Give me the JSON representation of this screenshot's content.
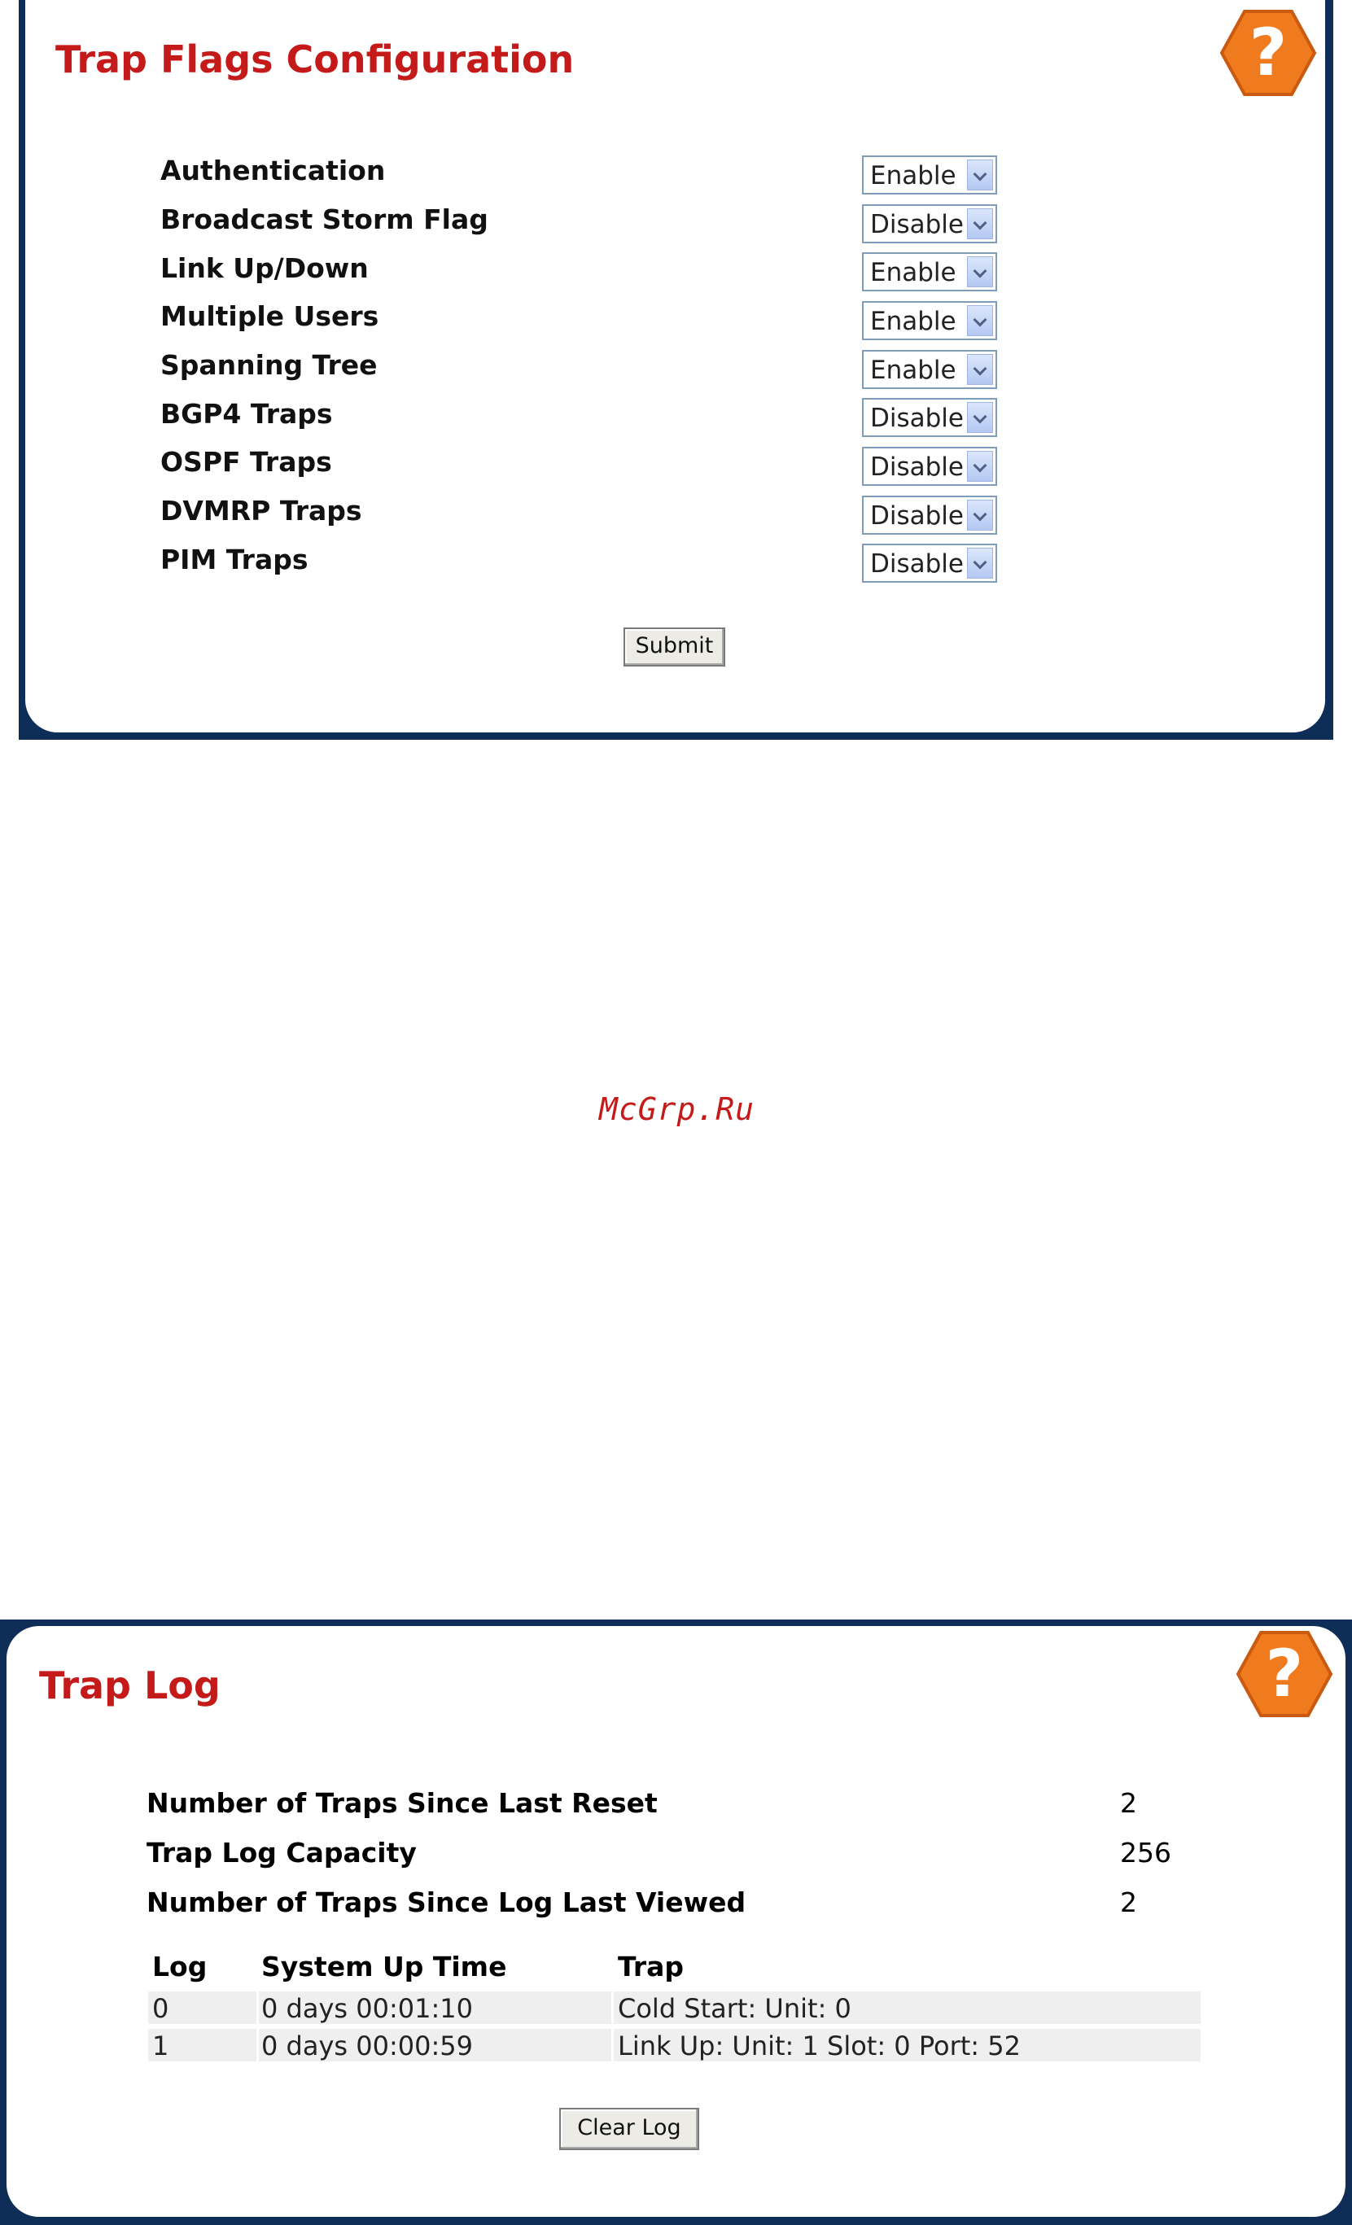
{
  "flags_panel": {
    "title": "Trap Flags Configuration",
    "rows": [
      {
        "label": "Authentication",
        "value": "Enable"
      },
      {
        "label": "Broadcast Storm Flag",
        "value": "Disable"
      },
      {
        "label": "Link Up/Down",
        "value": "Enable"
      },
      {
        "label": "Multiple Users",
        "value": "Enable"
      },
      {
        "label": "Spanning Tree",
        "value": "Enable"
      },
      {
        "label": "BGP4 Traps",
        "value": "Disable"
      },
      {
        "label": "OSPF Traps",
        "value": "Disable"
      },
      {
        "label": "DVMRP Traps",
        "value": "Disable"
      },
      {
        "label": "PIM Traps",
        "value": "Disable"
      }
    ],
    "submit_label": "Submit"
  },
  "watermark": "McGrp.Ru",
  "log_panel": {
    "title": "Trap Log",
    "stats": [
      {
        "label": "Number of Traps Since Last Reset",
        "value": "2"
      },
      {
        "label": "Trap Log Capacity",
        "value": "256"
      },
      {
        "label": "Number of Traps Since Log Last Viewed",
        "value": "2"
      }
    ],
    "table": {
      "headers": [
        "Log",
        "System Up Time",
        "Trap"
      ],
      "rows": [
        [
          "0",
          "0 days 00:01:10",
          "Cold Start: Unit: 0"
        ],
        [
          "1",
          "0 days 00:00:59",
          "Link Up: Unit: 1 Slot: 0 Port: 52"
        ]
      ]
    },
    "clear_label": "Clear Log"
  },
  "colors": {
    "title": "#c41a1a",
    "frame": "#0f2e57",
    "help_icon": "#f07a1e"
  },
  "icons": {
    "help": "help-icon"
  }
}
